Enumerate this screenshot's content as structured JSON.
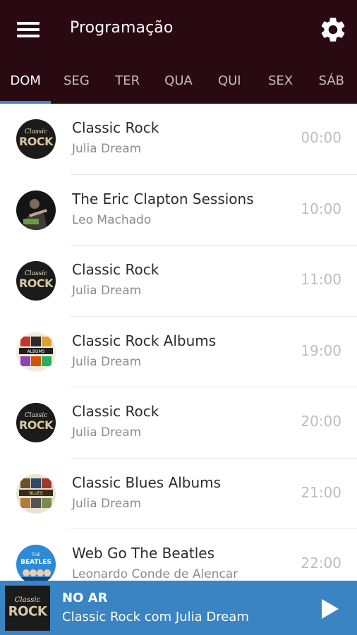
{
  "header": {
    "title": "Programação",
    "menu_icon": "hamburger-menu-icon",
    "settings_icon": "gear-icon"
  },
  "tabs": [
    {
      "label": "DOM",
      "active": true
    },
    {
      "label": "SEG",
      "active": false
    },
    {
      "label": "TER",
      "active": false
    },
    {
      "label": "QUA",
      "active": false
    },
    {
      "label": "QUI",
      "active": false
    },
    {
      "label": "SEX",
      "active": false
    },
    {
      "label": "SÁB",
      "active": false
    }
  ],
  "schedule": [
    {
      "title": "Classic Rock",
      "host": "Julia Dream",
      "time": "00:00",
      "art": "classic-rock"
    },
    {
      "title": "The Eric Clapton Sessions",
      "host": "Leo Machado",
      "time": "10:00",
      "art": "clapton"
    },
    {
      "title": "Classic Rock",
      "host": "Julia Dream",
      "time": "11:00",
      "art": "classic-rock"
    },
    {
      "title": "Classic Rock Albums",
      "host": "Julia Dream",
      "time": "19:00",
      "art": "rock-albums"
    },
    {
      "title": "Classic Rock",
      "host": "Julia Dream",
      "time": "20:00",
      "art": "classic-rock"
    },
    {
      "title": "Classic Blues Albums",
      "host": "Julia Dream",
      "time": "21:00",
      "art": "blues-albums"
    },
    {
      "title": "Web Go The Beatles",
      "host": "Leonardo Conde de Alencar",
      "time": "22:00",
      "art": "beatles"
    }
  ],
  "player": {
    "status": "NO AR",
    "now_playing": "Classic Rock com Julia Dream",
    "play_icon": "play-icon"
  },
  "colors": {
    "topbar": "#2a0a12",
    "tab_indicator": "#3d86c6",
    "player_bar": "#3a84c3"
  }
}
